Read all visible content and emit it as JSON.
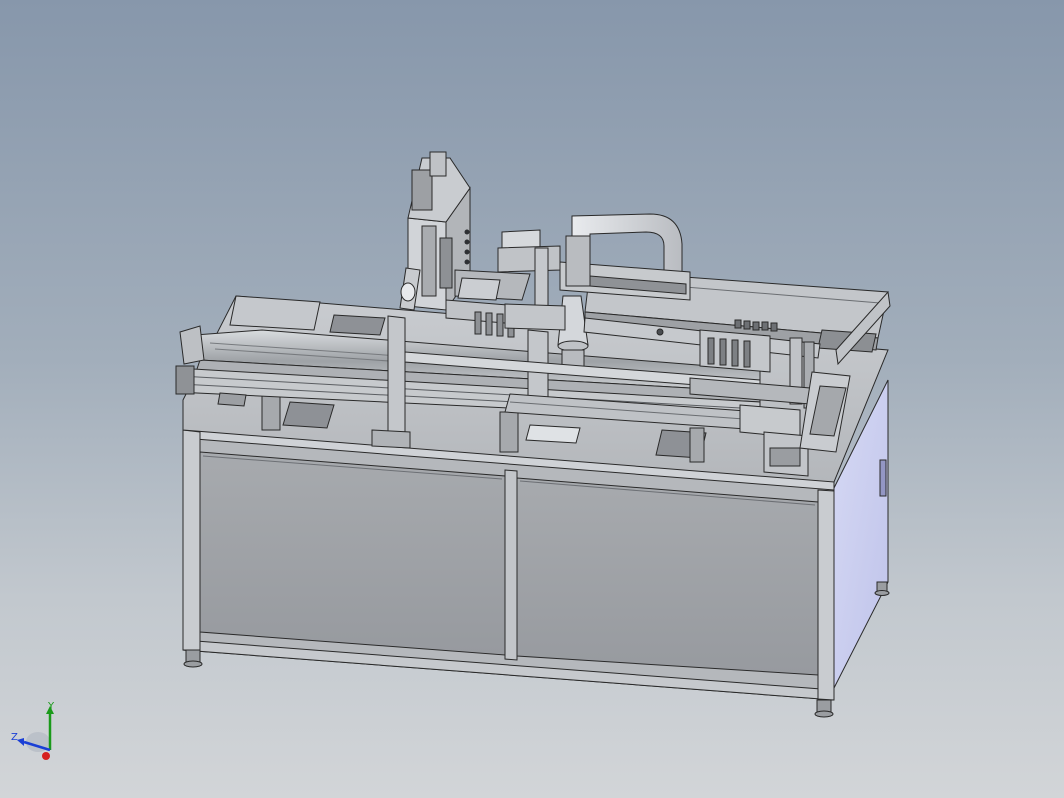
{
  "viewport": {
    "background_top": "#8797ab",
    "background_bottom": "#d2d5d8",
    "model": "automated-assembly-workcell",
    "display_style": "shaded-with-edges",
    "body_color": "#b9bcc0",
    "door_color": "#9fa2a6",
    "side_panel_color": "#c9cdf0",
    "edge_color": "#2a2a2a"
  },
  "triad": {
    "y_label": "Y",
    "z_label": "Z",
    "x_color": "#d62020",
    "y_color": "#1a9a1a",
    "z_color": "#1a3fd6"
  }
}
